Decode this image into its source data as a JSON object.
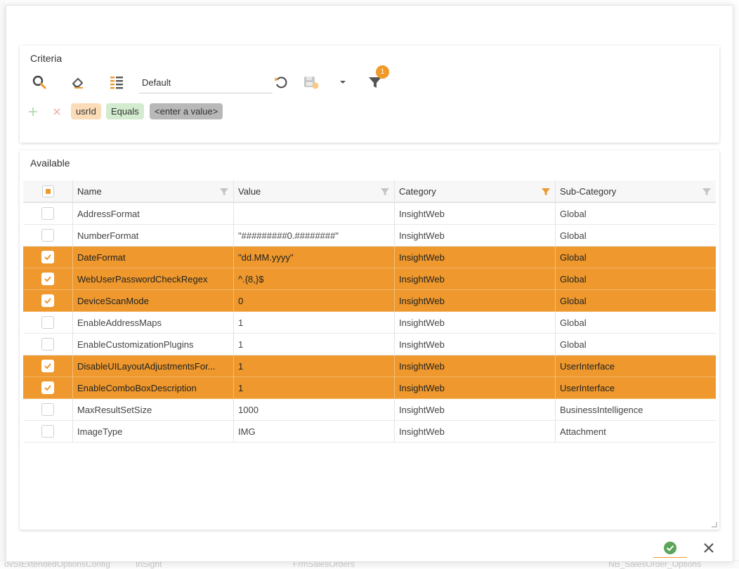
{
  "background": {
    "bottom_items": [
      "ovSIExtendedOptionsConfig",
      "InSight",
      "FrmSalesOrders",
      "NB_SalesOrder_Options"
    ]
  },
  "criteria": {
    "title": "Criteria",
    "preset": {
      "value": "Default"
    },
    "filter_badge": "1",
    "row": {
      "field": "usrId",
      "operator": "Equals",
      "value_placeholder": "<enter a value>"
    }
  },
  "available": {
    "title": "Available",
    "columns": [
      "Name",
      "Value",
      "Category",
      "Sub-Category"
    ],
    "rows": [
      {
        "name": "AddressFormat",
        "value": "",
        "category": "InsightWeb",
        "subcategory": "Global",
        "selected": false
      },
      {
        "name": "NumberFormat",
        "value": "\"#########0.########\"",
        "category": "InsightWeb",
        "subcategory": "Global",
        "selected": false
      },
      {
        "name": "DateFormat",
        "value": "\"dd.MM.yyyy\"",
        "category": "InsightWeb",
        "subcategory": "Global",
        "selected": true
      },
      {
        "name": "WebUserPasswordCheckRegex",
        "value": "^.{8,}$",
        "category": "InsightWeb",
        "subcategory": "Global",
        "selected": true
      },
      {
        "name": "DeviceScanMode",
        "value": "0",
        "category": "InsightWeb",
        "subcategory": "Global",
        "selected": true
      },
      {
        "name": "EnableAddressMaps",
        "value": "1",
        "category": "InsightWeb",
        "subcategory": "Global",
        "selected": false
      },
      {
        "name": "EnableCustomizationPlugins",
        "value": "1",
        "category": "InsightWeb",
        "subcategory": "Global",
        "selected": false
      },
      {
        "name": "DisableUILayoutAdjustmentsFor...",
        "value": "1",
        "category": "InsightWeb",
        "subcategory": "UserInterface",
        "selected": true
      },
      {
        "name": "EnableComboBoxDescription",
        "value": "1",
        "category": "InsightWeb",
        "subcategory": "UserInterface",
        "selected": true
      },
      {
        "name": "MaxResultSetSize",
        "value": "1000",
        "category": "InsightWeb",
        "subcategory": "BusinessIntelligence",
        "selected": false
      },
      {
        "name": "ImageType",
        "value": "IMG",
        "category": "InsightWeb",
        "subcategory": "Attachment",
        "selected": false
      }
    ]
  },
  "colors": {
    "accent": "#ee982d",
    "ok_green": "#5aa55a",
    "filter_inactive": "#c4c4c4"
  },
  "icons": {
    "search": "search-icon",
    "clear": "eraser-icon",
    "columns": "list-columns-icon",
    "reset": "undo-icon",
    "save": "save-preset-icon",
    "dropdown": "caret-down-icon",
    "filter": "filter-icon",
    "add": "plus-icon",
    "remove": "x-icon",
    "ok": "check-circle-icon",
    "close": "close-icon"
  }
}
